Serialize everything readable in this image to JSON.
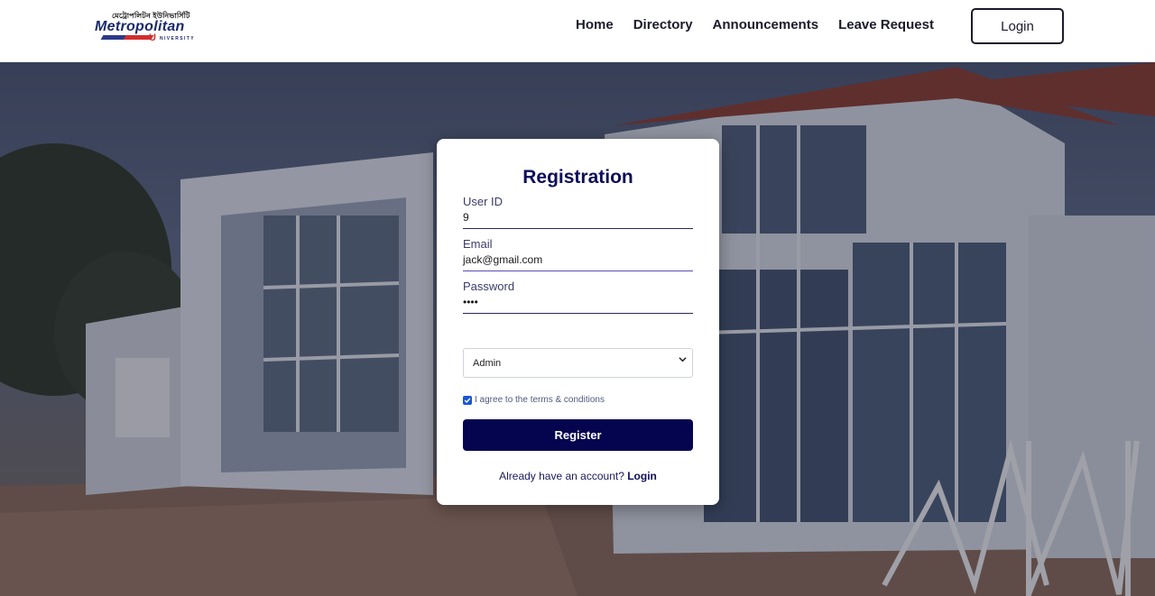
{
  "brand": {
    "logo_bangla": "মেট্রোপলিটন ইউনিভার্সিটি",
    "logo_text": "Metropolitan",
    "logo_u": "U",
    "logo_subtext": "NIVERSITY"
  },
  "nav": {
    "links": [
      "Home",
      "Directory",
      "Announcements",
      "Leave Request"
    ],
    "login_label": "Login"
  },
  "form": {
    "title": "Registration",
    "user_id": {
      "label": "User ID",
      "value": "9"
    },
    "email": {
      "label": "Email",
      "value": "jack@gmail.com"
    },
    "password": {
      "label": "Password",
      "value": "••••"
    },
    "role": {
      "selected": "Admin"
    },
    "terms": {
      "label": "I agree to the terms & conditions",
      "checked": true
    },
    "submit_label": "Register",
    "footer_text": "Already have an account?",
    "footer_link": "Login"
  },
  "colors": {
    "primary": "#05054f",
    "title": "#0d0d5a",
    "checkbox": "#1a56d6"
  }
}
